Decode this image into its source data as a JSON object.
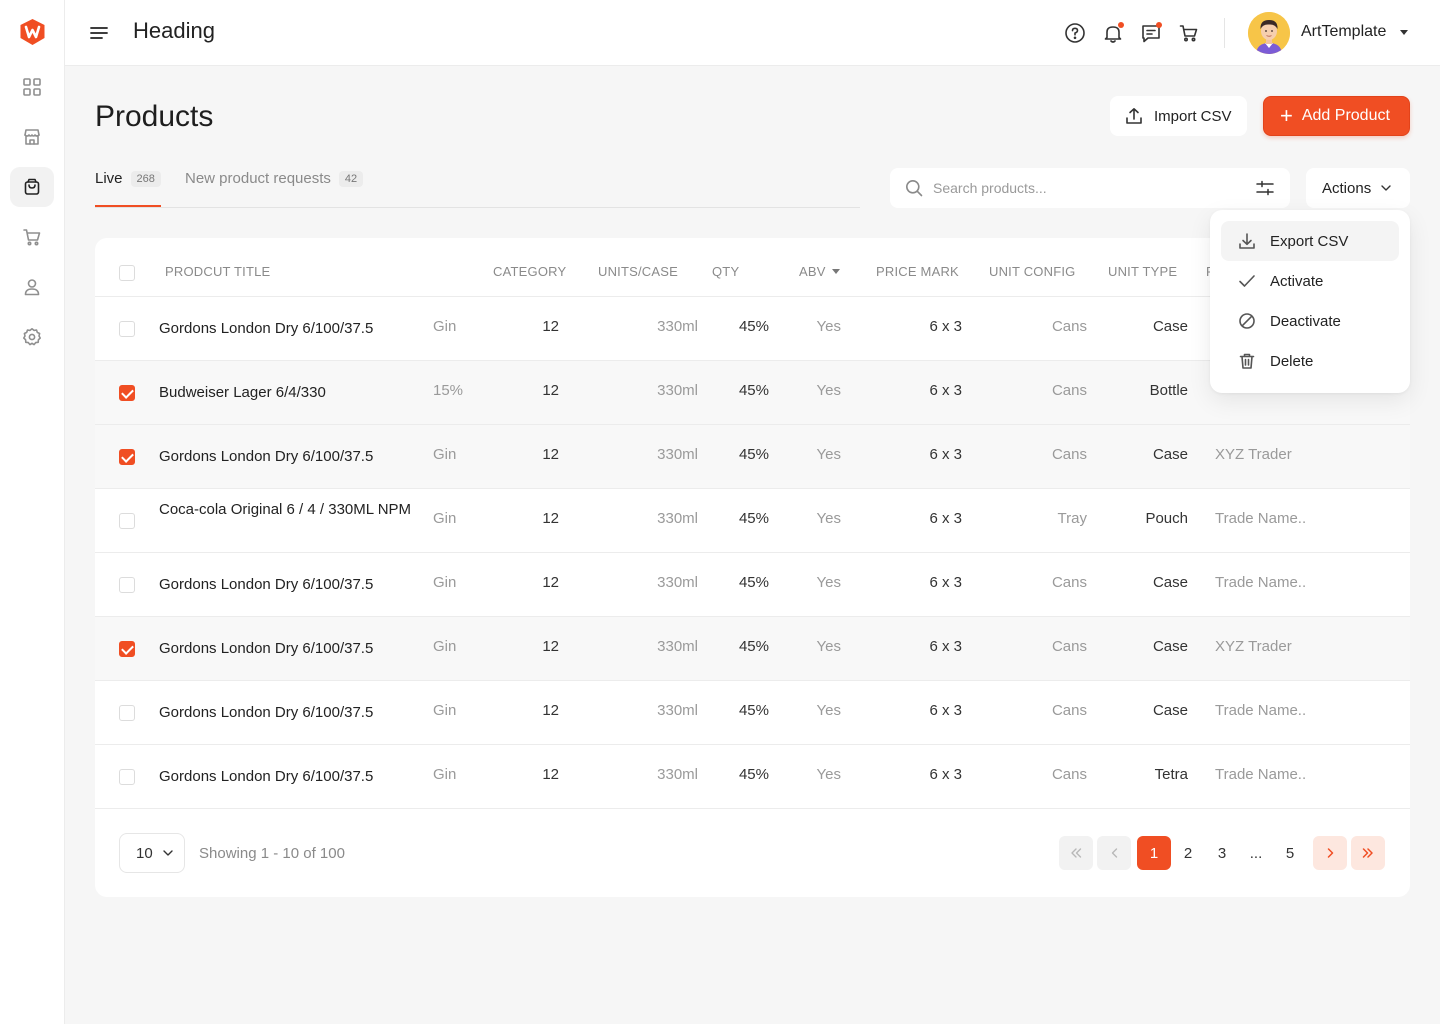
{
  "header": {
    "title": "Heading",
    "user": "ArtTemplate",
    "icons": [
      "help-icon",
      "bell-icon",
      "chat-icon",
      "cart-icon"
    ]
  },
  "sidebar": {
    "items": [
      "dashboard-icon",
      "store-icon",
      "bag-icon",
      "cart-icon",
      "user-icon",
      "settings-icon"
    ],
    "active": "bag-icon"
  },
  "page": {
    "title": "Products",
    "import_label": "Import CSV",
    "add_label": "Add Product",
    "add_icon": "+"
  },
  "tabs": [
    {
      "label": "Live",
      "count": "268"
    },
    {
      "label": "New product requests",
      "count": "42"
    }
  ],
  "search": {
    "placeholder": "Search products..."
  },
  "actions": {
    "label": "Actions",
    "menu": [
      "Export CSV",
      "Activate",
      "Deactivate",
      "Delete"
    ]
  },
  "table": {
    "headers": {
      "title": "PRODCUT TITLE",
      "category": "CATEGORY",
      "units": "UNITS/CASE",
      "qty": "QTY",
      "abv": "ABV",
      "price_mark": "PRICE MARK",
      "unit_config": "UNIT CONFIG",
      "unit_type": "UNIT TYPE",
      "trade": "F"
    },
    "rows": [
      {
        "checked": false,
        "title": "Gordons London Dry 6/100/37.5",
        "category": "Gin",
        "units": "12",
        "qty": "330ml",
        "abv": "45%",
        "price_mark": "Yes",
        "unit_config": "6 x 3",
        "unit_type": "Cans",
        "type": "Case",
        "trade": ""
      },
      {
        "checked": true,
        "title": "Budweiser Lager 6/4/330",
        "category": "15%",
        "units": "12",
        "qty": "330ml",
        "abv": "45%",
        "price_mark": "Yes",
        "unit_config": "6 x 3",
        "unit_type": "Cans",
        "type": "Bottle",
        "trade": ""
      },
      {
        "checked": true,
        "title": "Gordons London Dry 6/100/37.5",
        "category": "Gin",
        "units": "12",
        "qty": "330ml",
        "abv": "45%",
        "price_mark": "Yes",
        "unit_config": "6 x 3",
        "unit_type": "Cans",
        "type": "Case",
        "trade": "XYZ Trader"
      },
      {
        "checked": false,
        "title": "Coca-cola Original 6 / 4 / 330ML NPM",
        "category": "Gin",
        "units": "12",
        "qty": "330ml",
        "abv": "45%",
        "price_mark": "Yes",
        "unit_config": "6 x 3",
        "unit_type": "Tray",
        "type": "Pouch",
        "trade": "Trade Name.."
      },
      {
        "checked": false,
        "title": "Gordons London Dry 6/100/37.5",
        "category": "Gin",
        "units": "12",
        "qty": "330ml",
        "abv": "45%",
        "price_mark": "Yes",
        "unit_config": "6 x 3",
        "unit_type": "Cans",
        "type": "Case",
        "trade": "Trade Name.."
      },
      {
        "checked": true,
        "title": "Gordons London Dry 6/100/37.5",
        "category": "Gin",
        "units": "12",
        "qty": "330ml",
        "abv": "45%",
        "price_mark": "Yes",
        "unit_config": "6 x 3",
        "unit_type": "Cans",
        "type": "Case",
        "trade": "XYZ Trader"
      },
      {
        "checked": false,
        "title": "Gordons London Dry 6/100/37.5",
        "category": "Gin",
        "units": "12",
        "qty": "330ml",
        "abv": "45%",
        "price_mark": "Yes",
        "unit_config": "6 x 3",
        "unit_type": "Cans",
        "type": "Case",
        "trade": "Trade Name.."
      },
      {
        "checked": false,
        "title": "Gordons London Dry 6/100/37.5",
        "category": "Gin",
        "units": "12",
        "qty": "330ml",
        "abv": "45%",
        "price_mark": "Yes",
        "unit_config": "6 x 3",
        "unit_type": "Cans",
        "type": "Tetra",
        "trade": "Trade Name.."
      }
    ]
  },
  "pagination": {
    "page_size": "10",
    "info": "Showing 1 - 10 of 100",
    "pages": [
      "1",
      "2",
      "3",
      "...",
      "5"
    ],
    "current": "1"
  },
  "colors": {
    "accent": "#f04e23"
  }
}
